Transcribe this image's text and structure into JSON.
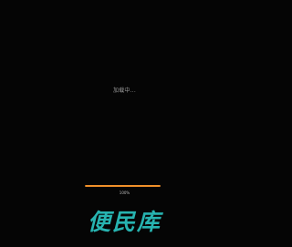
{
  "loading": {
    "message": "加载中..."
  },
  "progress": {
    "value": 1.0,
    "label": "100%"
  },
  "brand": {
    "name": "便民库"
  },
  "colors": {
    "background": "#050505",
    "progress_fill": "#f0902a",
    "brand": "#27b3b0"
  }
}
